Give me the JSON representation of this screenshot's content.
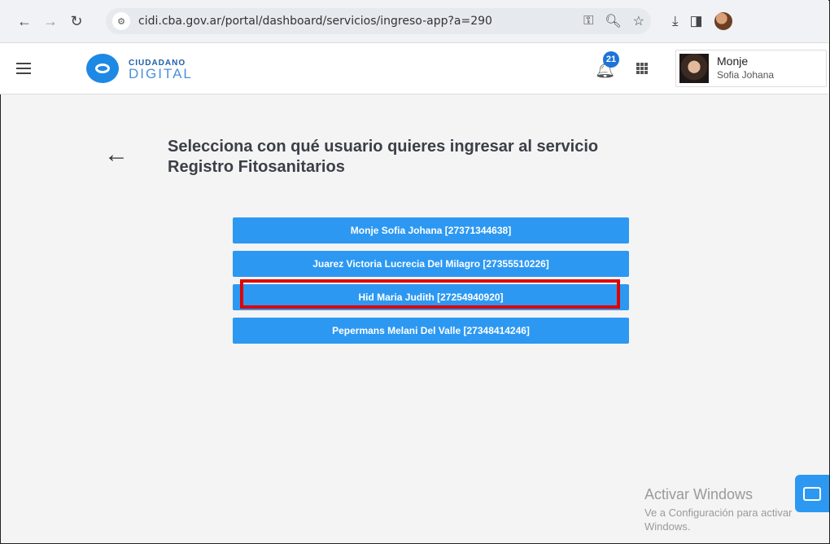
{
  "browser": {
    "url": "cidi.cba.gov.ar/portal/dashboard/servicios/ingreso-app?a=290"
  },
  "header": {
    "logo_top": "CIUDADANO",
    "logo_bottom": "DIGITAL",
    "notification_count": "21",
    "user_name": "Monje",
    "user_subname": "Sofia Johana"
  },
  "main": {
    "title": "Selecciona con qué usuario quieres ingresar al servicio Registro Fitosanitarios",
    "users": [
      {
        "label": "Monje Sofia Johana [27371344638]"
      },
      {
        "label": "Juarez Victoria Lucrecia Del Milagro [27355510226]"
      },
      {
        "label": "Hid Maria Judith [27254940920]"
      },
      {
        "label": "Pepermans Melani Del Valle [27348414246]"
      }
    ]
  },
  "watermark": {
    "line1": "Activar Windows",
    "line2": "Ve a Configuración para activar",
    "line3": "Windows."
  },
  "colors": {
    "accent": "#2d98f2",
    "highlight": "#e00000"
  }
}
